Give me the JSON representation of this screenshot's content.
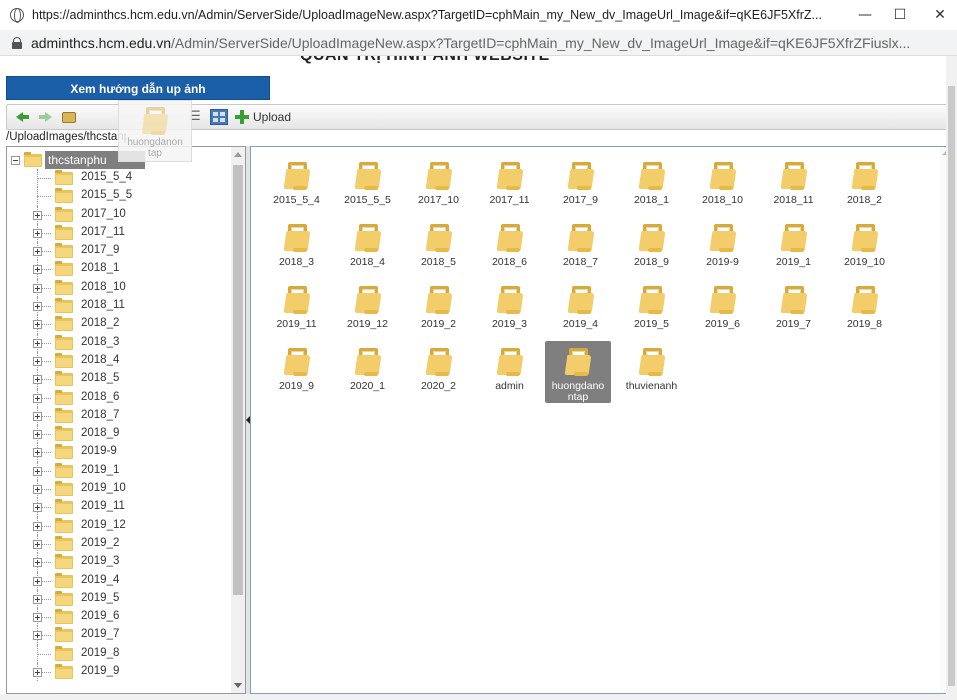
{
  "window": {
    "title": "https://adminthcs.hcm.edu.vn/Admin/ServerSide/UploadImageNew.aspx?TargetID=cphMain_my_New_dv_ImageUrl_Image&if=qKE6JF5XfrZ...",
    "minimize": "—",
    "maximize": "☐",
    "close": "✕"
  },
  "address": {
    "host": "adminthcs.hcm.edu.vn",
    "path": "/Admin/ServerSide/UploadImageNew.aspx?TargetID=cphMain_my_New_dv_ImageUrl_Image&if=qKE6JF5XfrZFiuslx..."
  },
  "page": {
    "heading": "QUẢN TRỊ HÌNH ẢNH WEBSITE",
    "guide_button": "Xem hướng dẫn up ảnh"
  },
  "toolbar": {
    "upload_label": "Upload"
  },
  "path": "/UploadImages/thcstanphu",
  "drag_ghost": {
    "label": "huongdanon tap"
  },
  "tree": {
    "root": "thcstanphu",
    "items": [
      {
        "label": "2015_5_4",
        "expandable": false
      },
      {
        "label": "2015_5_5",
        "expandable": false
      },
      {
        "label": "2017_10",
        "expandable": true
      },
      {
        "label": "2017_11",
        "expandable": true
      },
      {
        "label": "2017_9",
        "expandable": true
      },
      {
        "label": "2018_1",
        "expandable": true
      },
      {
        "label": "2018_10",
        "expandable": true
      },
      {
        "label": "2018_11",
        "expandable": true
      },
      {
        "label": "2018_2",
        "expandable": true
      },
      {
        "label": "2018_3",
        "expandable": true
      },
      {
        "label": "2018_4",
        "expandable": true
      },
      {
        "label": "2018_5",
        "expandable": true
      },
      {
        "label": "2018_6",
        "expandable": true
      },
      {
        "label": "2018_7",
        "expandable": true
      },
      {
        "label": "2018_9",
        "expandable": true
      },
      {
        "label": "2019-9",
        "expandable": true
      },
      {
        "label": "2019_1",
        "expandable": true
      },
      {
        "label": "2019_10",
        "expandable": true
      },
      {
        "label": "2019_11",
        "expandable": true
      },
      {
        "label": "2019_12",
        "expandable": true
      },
      {
        "label": "2019_2",
        "expandable": true
      },
      {
        "label": "2019_3",
        "expandable": true
      },
      {
        "label": "2019_4",
        "expandable": true
      },
      {
        "label": "2019_5",
        "expandable": true
      },
      {
        "label": "2019_6",
        "expandable": true
      },
      {
        "label": "2019_7",
        "expandable": true
      },
      {
        "label": "2019_8",
        "expandable": false
      },
      {
        "label": "2019_9",
        "expandable": true
      }
    ]
  },
  "folders": [
    {
      "label": "2015_5_4"
    },
    {
      "label": "2015_5_5"
    },
    {
      "label": "2017_10"
    },
    {
      "label": "2017_11"
    },
    {
      "label": "2017_9"
    },
    {
      "label": "2018_1"
    },
    {
      "label": "2018_10"
    },
    {
      "label": "2018_11"
    },
    {
      "label": "2018_2"
    },
    {
      "label": "2018_3"
    },
    {
      "label": "2018_4"
    },
    {
      "label": "2018_5"
    },
    {
      "label": "2018_6"
    },
    {
      "label": "2018_7"
    },
    {
      "label": "2018_9"
    },
    {
      "label": "2019-9"
    },
    {
      "label": "2019_1"
    },
    {
      "label": "2019_10"
    },
    {
      "label": "2019_11"
    },
    {
      "label": "2019_12"
    },
    {
      "label": "2019_2"
    },
    {
      "label": "2019_3"
    },
    {
      "label": "2019_4"
    },
    {
      "label": "2019_5"
    },
    {
      "label": "2019_6"
    },
    {
      "label": "2019_7"
    },
    {
      "label": "2019_8"
    },
    {
      "label": "2019_9"
    },
    {
      "label": "2020_1"
    },
    {
      "label": "2020_2"
    },
    {
      "label": "admin"
    },
    {
      "label": "huongdano ntap",
      "selected": true
    },
    {
      "label": "thuvienanh"
    }
  ],
  "colors": {
    "guide_button_bg": "#1b5fa8",
    "selected_bg": "#7f7f7f",
    "folder_yellow": "#f2cd6a",
    "pane_border": "#7da2ce"
  }
}
